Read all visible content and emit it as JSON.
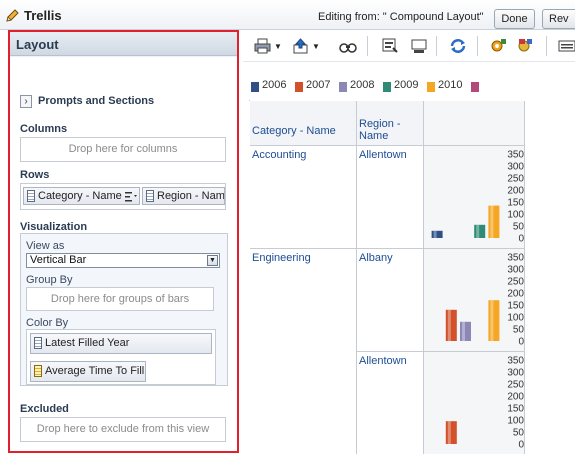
{
  "header": {
    "title": "Trellis",
    "editing": "Editing from: \" Compound Layout\"",
    "done_label": "Done",
    "rev_label": "Rev"
  },
  "layout_panel": {
    "title": "Layout",
    "prompts_label": "Prompts and Sections",
    "columns_label": "Columns",
    "columns_drop": "Drop here for columns",
    "rows_label": "Rows",
    "rows_items": [
      "Category - Name",
      "Region - Name"
    ],
    "visualization_label": "Visualization",
    "view_as_label": "View as",
    "view_as_value": "Vertical Bar",
    "group_by_label": "Group By",
    "group_by_drop": "Drop here for groups of bars",
    "color_by_label": "Color By",
    "color_by_items": [
      "Latest Filled Year",
      "Average Time To Fill"
    ],
    "excluded_label": "Excluded",
    "excluded_drop": "Drop here to exclude from this view"
  },
  "toolbar": {
    "icons": [
      "print-icon",
      "export-icon",
      "preview-icon",
      "properties-icon",
      "view-icon",
      "refresh-icon",
      "settings-icon",
      "add-view-icon",
      "more-icon"
    ]
  },
  "legend": {
    "items": [
      {
        "label": "2006",
        "color": "#2f4f86"
      },
      {
        "label": "2007",
        "color": "#d2512a"
      },
      {
        "label": "2008",
        "color": "#8b88b6"
      },
      {
        "label": "2009",
        "color": "#2f8a76"
      },
      {
        "label": "2010",
        "color": "#f5a623"
      },
      {
        "label": "",
        "color": "#b14a7b"
      }
    ]
  },
  "table": {
    "headers": [
      "Category - Name",
      "Region - Name"
    ],
    "rows": [
      {
        "category": "Accounting",
        "region": "Allentown"
      },
      {
        "category": "Engineering",
        "region": "Albany"
      },
      {
        "category": "",
        "region": "Allentown"
      }
    ]
  },
  "chart_data": [
    {
      "type": "bar",
      "categories": [
        "2006",
        "2007",
        "2008",
        "2009",
        "2010"
      ],
      "series": [
        {
          "values": [
            30,
            0,
            0,
            55,
            135
          ]
        }
      ],
      "ylim": [
        0,
        350
      ],
      "yticks": [
        0,
        50,
        100,
        150,
        200,
        250,
        300,
        350
      ]
    },
    {
      "type": "bar",
      "categories": [
        "2006",
        "2007",
        "2008",
        "2009",
        "2010"
      ],
      "series": [
        {
          "values": [
            0,
            130,
            80,
            0,
            170
          ]
        }
      ],
      "ylim": [
        0,
        350
      ],
      "yticks": [
        0,
        50,
        100,
        150,
        200,
        250,
        300,
        350
      ]
    },
    {
      "type": "bar",
      "categories": [
        "2006",
        "2007",
        "2008",
        "2009",
        "2010"
      ],
      "series": [
        {
          "values": [
            0,
            95,
            0,
            0,
            0
          ]
        }
      ],
      "ylim": [
        0,
        350
      ],
      "yticks": [
        0,
        50,
        100,
        150,
        200,
        250,
        300,
        350
      ]
    }
  ]
}
